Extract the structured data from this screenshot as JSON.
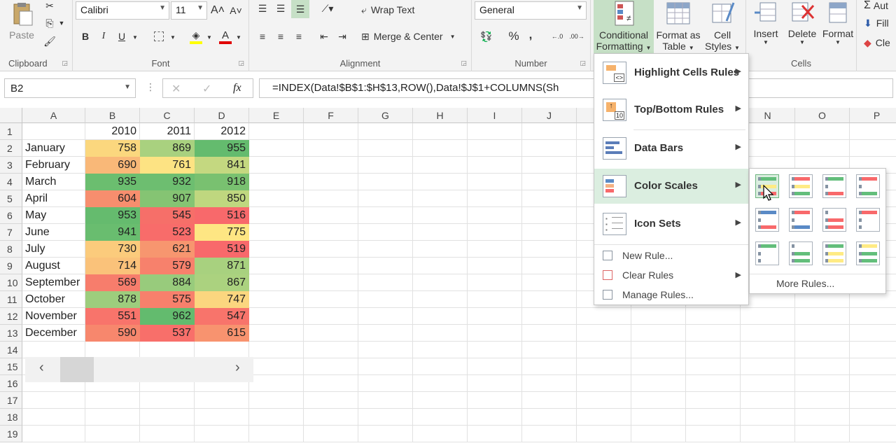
{
  "ribbon": {
    "clipboard": {
      "label": "Clipboard",
      "paste": "Paste"
    },
    "font": {
      "label": "Font",
      "name": "Calibri",
      "size": "11",
      "bold": "B",
      "italic": "I",
      "underline": "U",
      "grow": "A˄",
      "shrink": "A˅"
    },
    "alignment": {
      "label": "Alignment",
      "wrap": "Wrap Text",
      "merge": "Merge & Center"
    },
    "number": {
      "label": "Number",
      "format": "General",
      "percent": "%",
      "comma": ",",
      "inc_dec": ".0 .00",
      "dec_dec": ".00 .0"
    },
    "styles": {
      "cond_fmt_line1": "Conditional",
      "cond_fmt_line2": "Formatting",
      "fmt_table_line1": "Format as",
      "fmt_table_line2": "Table",
      "cell_styles_line1": "Cell",
      "cell_styles_line2": "Styles"
    },
    "cells": {
      "label": "Cells",
      "insert": "Insert",
      "delete": "Delete",
      "format": "Format"
    },
    "editing": {
      "autosum": "Aut",
      "fill": "Fill",
      "clear": "Cle"
    }
  },
  "formula_bar": {
    "name_box": "B2",
    "cancel": "✕",
    "enter": "✓",
    "fx": "fx",
    "formula": "=INDEX(Data!$B$1:$H$13,ROW(),Data!$J$1+COLUMNS(Sh"
  },
  "sheet": {
    "columns": [
      "A",
      "B",
      "C",
      "D",
      "E",
      "F",
      "G",
      "H",
      "I",
      "J",
      "K",
      "L",
      "M",
      "N",
      "O",
      "P"
    ],
    "rows": [
      "1",
      "2",
      "3",
      "4",
      "5",
      "6",
      "7",
      "8",
      "9",
      "10",
      "11",
      "12",
      "13",
      "14",
      "15",
      "16",
      "17",
      "18",
      "19"
    ],
    "header_row": [
      "",
      "2010",
      "2011",
      "2012"
    ],
    "data": [
      {
        "month": "January",
        "v": [
          "758",
          "869",
          "955"
        ],
        "c": [
          "#fbd77e",
          "#a9d17f",
          "#64bb6e"
        ]
      },
      {
        "month": "February",
        "v": [
          "690",
          "761",
          "841"
        ],
        "c": [
          "#f9b878",
          "#fde383",
          "#c4d880"
        ]
      },
      {
        "month": "March",
        "v": [
          "935",
          "932",
          "918"
        ],
        "c": [
          "#6bbe6f",
          "#6dbe70",
          "#79c170"
        ]
      },
      {
        "month": "April",
        "v": [
          "604",
          "907",
          "850"
        ],
        "c": [
          "#f78e6e",
          "#85c473",
          "#bfd77f"
        ]
      },
      {
        "month": "May",
        "v": [
          "953",
          "545",
          "516"
        ],
        "c": [
          "#65bb6e",
          "#f66f69",
          "#f8696b"
        ]
      },
      {
        "month": "June",
        "v": [
          "941",
          "523",
          "775"
        ],
        "c": [
          "#69bd6f",
          "#f86c6a",
          "#fee683"
        ]
      },
      {
        "month": "July",
        "v": [
          "730",
          "621",
          "519"
        ],
        "c": [
          "#fbcb7c",
          "#f7966f",
          "#f8696b"
        ]
      },
      {
        "month": "August",
        "v": [
          "714",
          "579",
          "871"
        ],
        "c": [
          "#fac27a",
          "#f7816c",
          "#a8d17f"
        ]
      },
      {
        "month": "September",
        "v": [
          "569",
          "884",
          "867"
        ],
        "c": [
          "#f77d6c",
          "#98cb7c",
          "#abd27f"
        ]
      },
      {
        "month": "October",
        "v": [
          "878",
          "575",
          "747"
        ],
        "c": [
          "#9dcd7d",
          "#f7806c",
          "#fbd67f"
        ]
      },
      {
        "month": "November",
        "v": [
          "551",
          "962",
          "547"
        ],
        "c": [
          "#f8746b",
          "#63bb6e",
          "#f8746b"
        ]
      },
      {
        "month": "December",
        "v": [
          "590",
          "537",
          "615"
        ],
        "c": [
          "#f7876d",
          "#f86f6a",
          "#f8936f"
        ]
      }
    ]
  },
  "cf_menu": {
    "highlight": "Highlight Cells Rules",
    "topbottom": "Top/Bottom Rules",
    "databars": "Data Bars",
    "colorscales": "Color Scales",
    "iconsets": "Icon Sets",
    "newrule": "New Rule...",
    "clearrules": "Clear Rules",
    "managerules": "Manage Rules..."
  },
  "color_scales": {
    "more_rules": "More Rules...",
    "swatches": [
      [
        "#63be7b",
        "#ffeb84",
        "#f8696b"
      ],
      [
        "#f8696b",
        "#ffeb84",
        "#63be7b"
      ],
      [
        "#63be7b",
        "#ffffff",
        "#f8696b"
      ],
      [
        "#f8696b",
        "#ffffff",
        "#63be7b"
      ],
      [
        "#5a8ac6",
        "#ffffff",
        "#f8696b"
      ],
      [
        "#f8696b",
        "#ffffff",
        "#5a8ac6"
      ],
      [
        "#ffffff",
        "#f8696b",
        "#f8696b"
      ],
      [
        "#f8696b",
        "#ffffff",
        "#ffffff"
      ],
      [
        "#63be7b",
        "#ffffff",
        "#ffffff"
      ],
      [
        "#ffffff",
        "#63be7b",
        "#63be7b"
      ],
      [
        "#63be7b",
        "#ffeb84",
        "#ffeb84"
      ],
      [
        "#ffeb84",
        "#63be7b",
        "#63be7b"
      ]
    ]
  }
}
